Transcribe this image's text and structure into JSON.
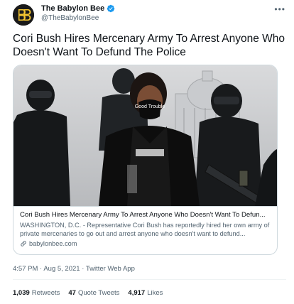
{
  "account": {
    "display_name": "The Babylon Bee",
    "handle": "@TheBabylonBee",
    "avatar_icon": "bee-logo-icon",
    "verified_icon": "verified-badge-icon",
    "verified_color": "#1d9bf0"
  },
  "tweet": {
    "text": "Cori Bush Hires Mercenary Army To Arrest Anyone Who Doesn't Want To Defund The Police"
  },
  "card": {
    "image_caption": "Good Trouble",
    "title": "Cori Bush Hires Mercenary Army To Arrest Anyone Who Doesn't Want To Defun...",
    "description": "WASHINGTON, D.C. - Representative Cori Bush has reportedly hired her own army of private mercenaries to go out and arrest anyone who doesn't want to defund...",
    "domain": "babylonbee.com"
  },
  "meta": {
    "time": "4:57 PM",
    "date": "Aug 5, 2021",
    "source": "Twitter Web App",
    "separator": "·"
  },
  "stats": {
    "retweets": "1,039",
    "retweets_label": "Retweets",
    "quotes": "47",
    "quotes_label": "Quote Tweets",
    "likes": "4,917",
    "likes_label": "Likes"
  },
  "icons": {
    "more": "more-options-icon",
    "link": "link-icon"
  }
}
